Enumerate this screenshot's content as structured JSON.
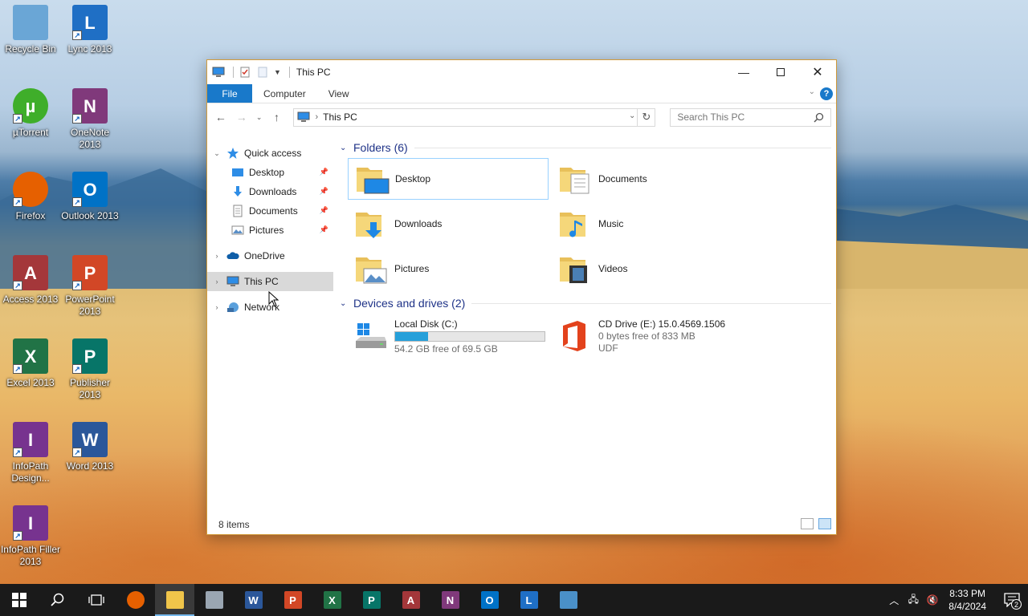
{
  "desktop": {
    "icons": [
      {
        "label": "Recycle Bin",
        "icon": "recycle-bin-icon",
        "color": "#6aa6d6",
        "glyph": ""
      },
      {
        "label": "Lync 2013",
        "icon": "lync-icon",
        "color": "#1f6fc5",
        "glyph": "L"
      },
      {
        "label": "µTorrent",
        "icon": "utorrent-icon",
        "color": "#3fae2a",
        "glyph": "µ"
      },
      {
        "label": "OneNote 2013",
        "icon": "onenote-icon",
        "color": "#80397b",
        "glyph": "N"
      },
      {
        "label": "Firefox",
        "icon": "firefox-icon",
        "color": "#e66000",
        "glyph": ""
      },
      {
        "label": "Outlook 2013",
        "icon": "outlook-icon",
        "color": "#0072c6",
        "glyph": "O"
      },
      {
        "label": "Access 2013",
        "icon": "access-icon",
        "color": "#a4373a",
        "glyph": "A"
      },
      {
        "label": "PowerPoint 2013",
        "icon": "powerpoint-icon",
        "color": "#d24726",
        "glyph": "P"
      },
      {
        "label": "Excel 2013",
        "icon": "excel-icon",
        "color": "#217346",
        "glyph": "X"
      },
      {
        "label": "Publisher 2013",
        "icon": "publisher-icon",
        "color": "#077568",
        "glyph": "P"
      },
      {
        "label": "InfoPath Design...",
        "icon": "infopath-designer-icon",
        "color": "#77338f",
        "glyph": "I"
      },
      {
        "label": "Word 2013",
        "icon": "word-icon",
        "color": "#2b579a",
        "glyph": "W"
      },
      {
        "label": "InfoPath Filler 2013",
        "icon": "infopath-filler-icon",
        "color": "#77338f",
        "glyph": "I"
      }
    ]
  },
  "window": {
    "title": "This PC",
    "ribbon": {
      "tabs": [
        "File",
        "Computer",
        "View"
      ],
      "help": "?"
    },
    "address": {
      "path": "This PC"
    },
    "search": {
      "placeholder": "Search This PC"
    },
    "navpane": {
      "quick_access": "Quick access",
      "pinned": [
        "Desktop",
        "Downloads",
        "Documents",
        "Pictures"
      ],
      "onedrive": "OneDrive",
      "this_pc": "This PC",
      "network": "Network"
    },
    "content": {
      "folders_header": "Folders (6)",
      "folders": [
        "Desktop",
        "Documents",
        "Downloads",
        "Music",
        "Pictures",
        "Videos"
      ],
      "drives_header": "Devices and drives (2)",
      "local_disk": {
        "name": "Local Disk (C:)",
        "free": "54.2 GB free of 69.5 GB",
        "used_fraction": 0.22
      },
      "cd_drive": {
        "name": "CD Drive (E:) 15.0.4569.1506",
        "free": "0 bytes free of 833 MB",
        "fs": "UDF"
      }
    },
    "status": {
      "items": "8 items"
    }
  },
  "taskbar": {
    "time": "8:33 PM",
    "date": "8/4/2024",
    "notification_count": "2",
    "apps": [
      {
        "icon": "firefox-icon",
        "color": "#e66000",
        "glyph": ""
      },
      {
        "icon": "file-explorer-icon",
        "color": "#f0c54a",
        "glyph": ""
      },
      {
        "icon": "network-app-icon",
        "color": "#9aa6b2",
        "glyph": ""
      },
      {
        "icon": "word-icon",
        "color": "#2b579a",
        "glyph": "W"
      },
      {
        "icon": "powerpoint-icon",
        "color": "#d24726",
        "glyph": "P"
      },
      {
        "icon": "excel-icon",
        "color": "#217346",
        "glyph": "X"
      },
      {
        "icon": "publisher-icon",
        "color": "#077568",
        "glyph": "P"
      },
      {
        "icon": "access-icon",
        "color": "#a4373a",
        "glyph": "A"
      },
      {
        "icon": "onenote-icon",
        "color": "#80397b",
        "glyph": "N"
      },
      {
        "icon": "outlook-icon",
        "color": "#0072c6",
        "glyph": "O"
      },
      {
        "icon": "lync-icon",
        "color": "#1f6fc5",
        "glyph": "L"
      },
      {
        "icon": "remote-desktop-icon",
        "color": "#4a90c8",
        "glyph": ""
      }
    ]
  }
}
